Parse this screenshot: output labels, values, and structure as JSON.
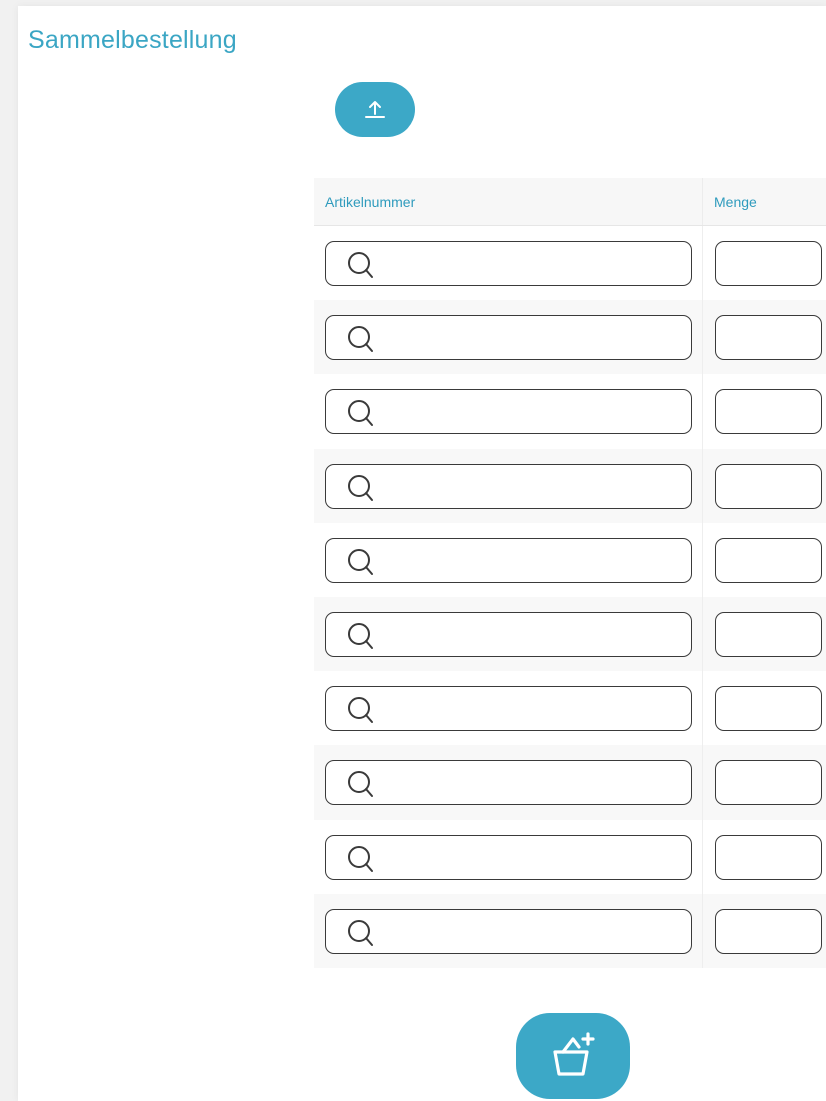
{
  "page": {
    "title": "Sammelbestellung"
  },
  "actions": {
    "upload_icon": "upload-icon",
    "add_to_basket_icon": "basket-add-icon"
  },
  "table": {
    "columns": {
      "article": "Artikelnummer",
      "quantity": "Menge"
    },
    "rows": [
      {
        "article": "",
        "quantity": ""
      },
      {
        "article": "",
        "quantity": ""
      },
      {
        "article": "",
        "quantity": ""
      },
      {
        "article": "",
        "quantity": ""
      },
      {
        "article": "",
        "quantity": ""
      },
      {
        "article": "",
        "quantity": ""
      },
      {
        "article": "",
        "quantity": ""
      },
      {
        "article": "",
        "quantity": ""
      },
      {
        "article": "",
        "quantity": ""
      },
      {
        "article": "",
        "quantity": ""
      }
    ]
  },
  "colors": {
    "accent": "#3ca8c7",
    "title": "#3ba6c4",
    "header_text": "#2f9bbd"
  }
}
